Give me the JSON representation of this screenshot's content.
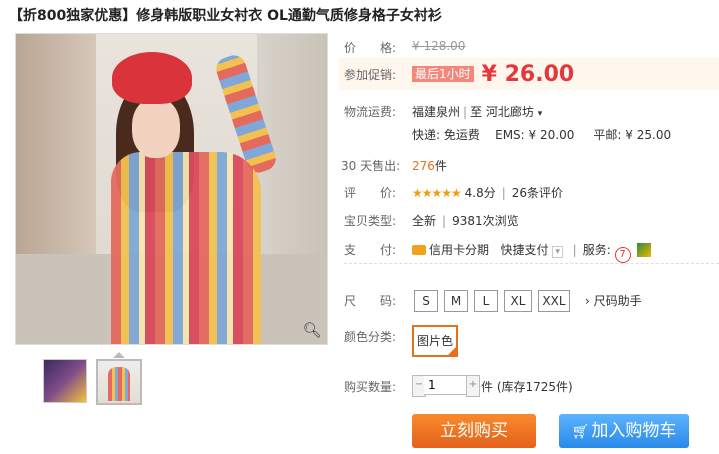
{
  "title": "【折800独家优惠】修身韩版职业女衬衣 OL通勤气质修身格子女衬衫",
  "price": {
    "label": "价　　格:",
    "original": "¥ 128.00"
  },
  "promo": {
    "label": "参加促销:",
    "tag": "最后1小时",
    "price": "¥ 26.00"
  },
  "shipping": {
    "label": "物流运费:",
    "from": "福建泉州",
    "to_prefix": "至",
    "to": "河北廊坊",
    "express": "快递: 免运费",
    "ems": "EMS: ¥ 20.00",
    "mail": "平邮: ¥ 25.00"
  },
  "sold": {
    "label": "30 天售出:",
    "count": "276",
    "unit": "件"
  },
  "rating": {
    "label": "评　　价:",
    "stars": "★★★★★",
    "score": "4.8分",
    "reviews": "26条评价"
  },
  "item_type": {
    "label": "宝贝类型:",
    "value": "全新",
    "views": "9381次浏览"
  },
  "payment": {
    "label": "支　　付:",
    "credit": "信用卡分期",
    "quick": "快捷支付",
    "service_label": "服务:"
  },
  "size": {
    "label": "尺　　码:",
    "options": [
      "S",
      "M",
      "L",
      "XL",
      "XXL"
    ],
    "helper": "尺码助手"
  },
  "color": {
    "label": "颜色分类:",
    "selected": "图片色"
  },
  "quantity": {
    "label": "购买数量:",
    "value": "1",
    "stock": "件 (库存1725件)"
  },
  "buttons": {
    "buy": "立刻购买",
    "cart": "加入购物车"
  },
  "icons": [
    "zoom-icon",
    "chevron-down-icon",
    "credit-card-icon",
    "cart-icon",
    "service-icon"
  ],
  "colors": {
    "accent_orange": "#e4711b",
    "price_red": "#e4393c",
    "cart_blue": "#2a8ae8"
  }
}
